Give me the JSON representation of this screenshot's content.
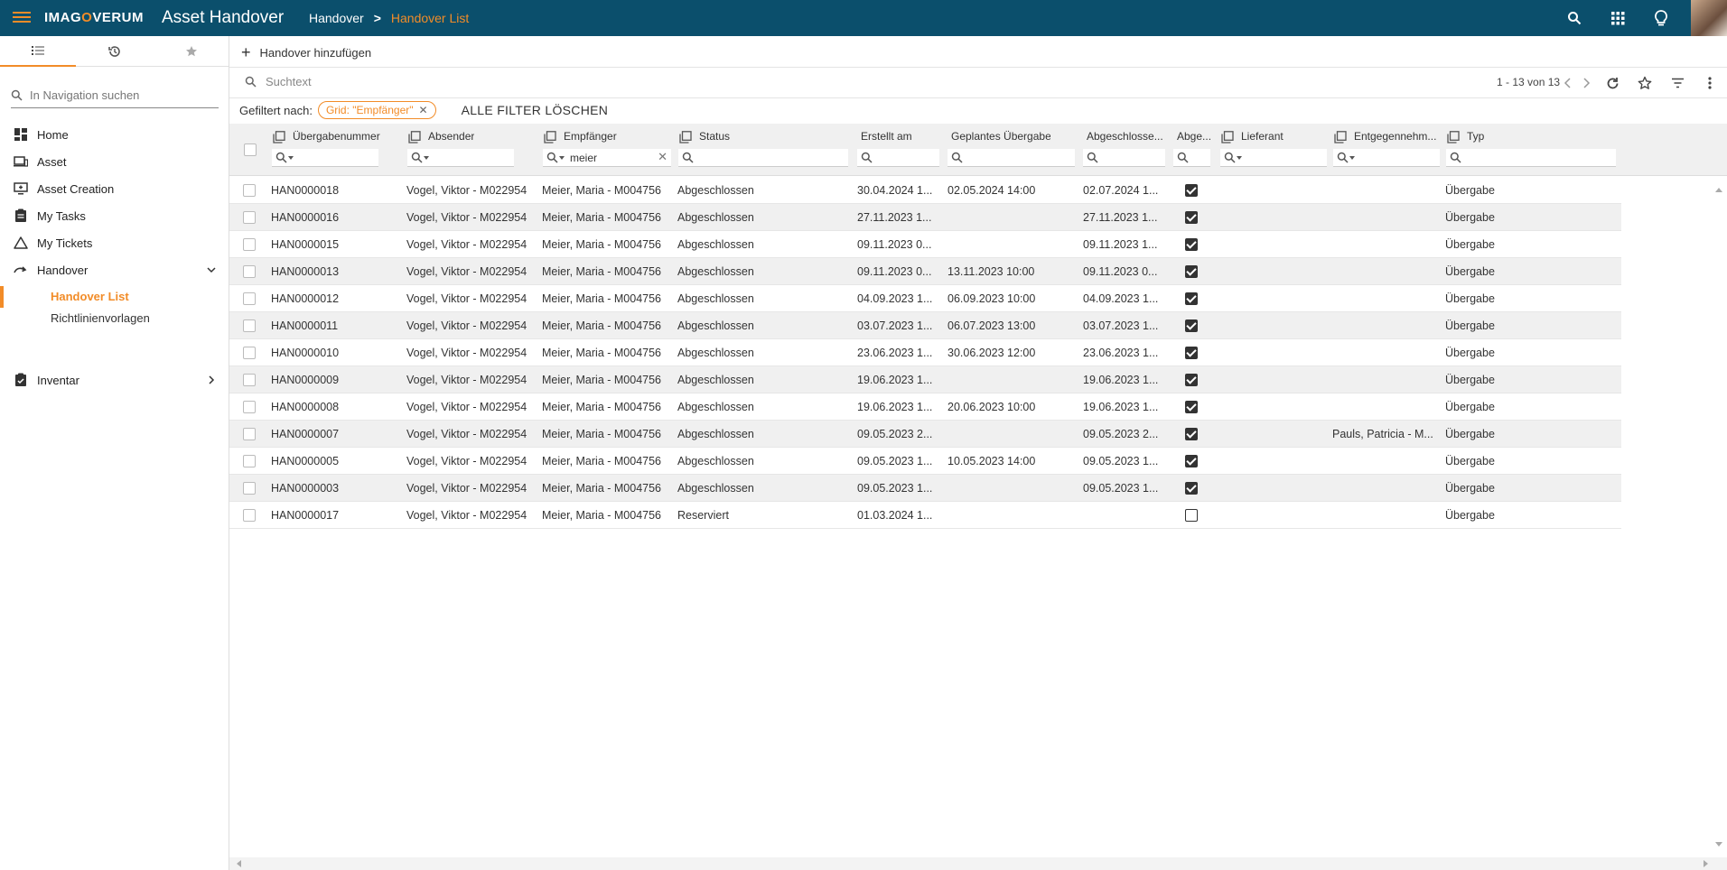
{
  "header": {
    "logo_text_1": "IMAG",
    "logo_text_2": "O",
    "logo_text_3": "VERUM",
    "app_title": "Asset Handover",
    "breadcrumb_parent": "Handover",
    "breadcrumb_current": "Handover List",
    "accent": "#f28c28",
    "bar_color": "#0b4f6c"
  },
  "sidebar": {
    "search_placeholder": "In Navigation suchen",
    "items": [
      {
        "label": "Home",
        "icon": "dashboard-icon"
      },
      {
        "label": "Asset",
        "icon": "devices-icon"
      },
      {
        "label": "Asset Creation",
        "icon": "asset-creation-icon"
      },
      {
        "label": "My Tasks",
        "icon": "clipboard-icon"
      },
      {
        "label": "My Tickets",
        "icon": "warning-triangle-icon"
      },
      {
        "label": "Handover",
        "icon": "handover-arrow-icon"
      },
      {
        "label": "Inventar",
        "icon": "inventory-check-icon"
      }
    ],
    "sub_items": [
      "Handover List",
      "Richtlinienvorlagen"
    ]
  },
  "toolbar": {
    "add_label": "Handover hinzufügen",
    "search_placeholder": "Suchtext",
    "pager": "1 - 13 von 13"
  },
  "filters": {
    "label": "Gefiltert nach:",
    "chip": "Grid: \"Empfänger\"",
    "clear_all": "ALLE FILTER LÖSCHEN"
  },
  "columns": [
    {
      "title": "Übergabenummer",
      "filter": ""
    },
    {
      "title": "Absender",
      "filter": ""
    },
    {
      "title": "Empfänger",
      "filter": "meier"
    },
    {
      "title": "Status",
      "filter": ""
    },
    {
      "title": "Erstellt am",
      "filter": ""
    },
    {
      "title": "Geplantes Übergabedat...",
      "filter": ""
    },
    {
      "title": "Abgeschlosse...",
      "filter": ""
    },
    {
      "title": "Abge...",
      "filter": ""
    },
    {
      "title": "Lieferant",
      "filter": ""
    },
    {
      "title": "Entgegennehm...",
      "filter": ""
    },
    {
      "title": "Typ",
      "filter": ""
    }
  ],
  "rows": [
    {
      "nr": "HAN0000018",
      "absender": "Vogel, Viktor - M022954",
      "empfaenger": "Meier, Maria - M004756",
      "status": "Abgeschlossen",
      "erstellt": "30.04.2024 1...",
      "geplant": "02.05.2024 14:00",
      "abgeschlossen_am": "02.07.2024 1...",
      "abgeschlossen": true,
      "lieferant": "",
      "entgegennehmer": "",
      "typ": "Übergabe"
    },
    {
      "nr": "HAN0000016",
      "absender": "Vogel, Viktor - M022954",
      "empfaenger": "Meier, Maria - M004756",
      "status": "Abgeschlossen",
      "erstellt": "27.11.2023 1...",
      "geplant": "",
      "abgeschlossen_am": "27.11.2023 1...",
      "abgeschlossen": true,
      "lieferant": "",
      "entgegennehmer": "",
      "typ": "Übergabe"
    },
    {
      "nr": "HAN0000015",
      "absender": "Vogel, Viktor - M022954",
      "empfaenger": "Meier, Maria - M004756",
      "status": "Abgeschlossen",
      "erstellt": "09.11.2023 0...",
      "geplant": "",
      "abgeschlossen_am": "09.11.2023 1...",
      "abgeschlossen": true,
      "lieferant": "",
      "entgegennehmer": "",
      "typ": "Übergabe"
    },
    {
      "nr": "HAN0000013",
      "absender": "Vogel, Viktor - M022954",
      "empfaenger": "Meier, Maria - M004756",
      "status": "Abgeschlossen",
      "erstellt": "09.11.2023 0...",
      "geplant": "13.11.2023 10:00",
      "abgeschlossen_am": "09.11.2023 0...",
      "abgeschlossen": true,
      "lieferant": "",
      "entgegennehmer": "",
      "typ": "Übergabe"
    },
    {
      "nr": "HAN0000012",
      "absender": "Vogel, Viktor - M022954",
      "empfaenger": "Meier, Maria - M004756",
      "status": "Abgeschlossen",
      "erstellt": "04.09.2023 1...",
      "geplant": "06.09.2023 10:00",
      "abgeschlossen_am": "04.09.2023 1...",
      "abgeschlossen": true,
      "lieferant": "",
      "entgegennehmer": "",
      "typ": "Übergabe"
    },
    {
      "nr": "HAN0000011",
      "absender": "Vogel, Viktor - M022954",
      "empfaenger": "Meier, Maria - M004756",
      "status": "Abgeschlossen",
      "erstellt": "03.07.2023 1...",
      "geplant": "06.07.2023 13:00",
      "abgeschlossen_am": "03.07.2023 1...",
      "abgeschlossen": true,
      "lieferant": "",
      "entgegennehmer": "",
      "typ": "Übergabe"
    },
    {
      "nr": "HAN0000010",
      "absender": "Vogel, Viktor - M022954",
      "empfaenger": "Meier, Maria - M004756",
      "status": "Abgeschlossen",
      "erstellt": "23.06.2023 1...",
      "geplant": "30.06.2023 12:00",
      "abgeschlossen_am": "23.06.2023 1...",
      "abgeschlossen": true,
      "lieferant": "",
      "entgegennehmer": "",
      "typ": "Übergabe"
    },
    {
      "nr": "HAN0000009",
      "absender": "Vogel, Viktor - M022954",
      "empfaenger": "Meier, Maria - M004756",
      "status": "Abgeschlossen",
      "erstellt": "19.06.2023 1...",
      "geplant": "",
      "abgeschlossen_am": "19.06.2023 1...",
      "abgeschlossen": true,
      "lieferant": "",
      "entgegennehmer": "",
      "typ": "Übergabe"
    },
    {
      "nr": "HAN0000008",
      "absender": "Vogel, Viktor - M022954",
      "empfaenger": "Meier, Maria - M004756",
      "status": "Abgeschlossen",
      "erstellt": "19.06.2023 1...",
      "geplant": "20.06.2023 10:00",
      "abgeschlossen_am": "19.06.2023 1...",
      "abgeschlossen": true,
      "lieferant": "",
      "entgegennehmer": "",
      "typ": "Übergabe"
    },
    {
      "nr": "HAN0000007",
      "absender": "Vogel, Viktor - M022954",
      "empfaenger": "Meier, Maria - M004756",
      "status": "Abgeschlossen",
      "erstellt": "09.05.2023 2...",
      "geplant": "",
      "abgeschlossen_am": "09.05.2023 2...",
      "abgeschlossen": true,
      "lieferant": "",
      "entgegennehmer": "Pauls, Patricia - M...",
      "typ": "Übergabe"
    },
    {
      "nr": "HAN0000005",
      "absender": "Vogel, Viktor - M022954",
      "empfaenger": "Meier, Maria - M004756",
      "status": "Abgeschlossen",
      "erstellt": "09.05.2023 1...",
      "geplant": "10.05.2023 14:00",
      "abgeschlossen_am": "09.05.2023 1...",
      "abgeschlossen": true,
      "lieferant": "",
      "entgegennehmer": "",
      "typ": "Übergabe"
    },
    {
      "nr": "HAN0000003",
      "absender": "Vogel, Viktor - M022954",
      "empfaenger": "Meier, Maria - M004756",
      "status": "Abgeschlossen",
      "erstellt": "09.05.2023 1...",
      "geplant": "",
      "abgeschlossen_am": "09.05.2023 1...",
      "abgeschlossen": true,
      "lieferant": "",
      "entgegennehmer": "",
      "typ": "Übergabe"
    },
    {
      "nr": "HAN0000017",
      "absender": "Vogel, Viktor - M022954",
      "empfaenger": "Meier, Maria - M004756",
      "status": "Reserviert",
      "erstellt": "01.03.2024 1...",
      "geplant": "",
      "abgeschlossen_am": "",
      "abgeschlossen": false,
      "lieferant": "",
      "entgegennehmer": "",
      "typ": "Übergabe"
    }
  ]
}
